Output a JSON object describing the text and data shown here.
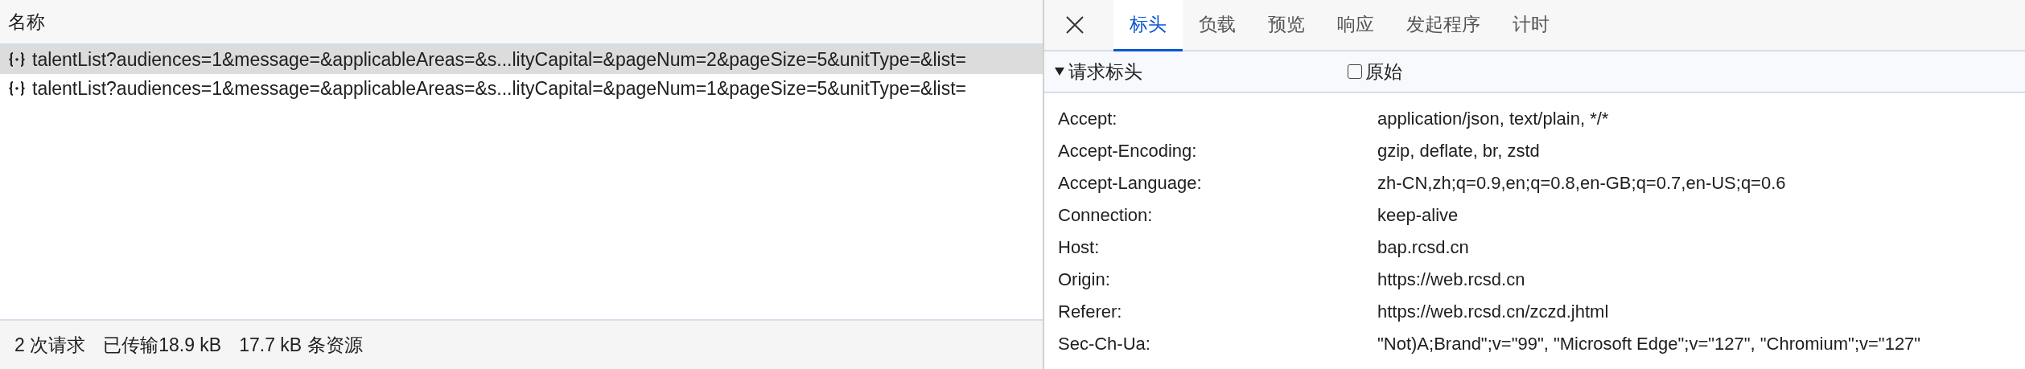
{
  "request_list": {
    "column_header": "名称",
    "rows": [
      {
        "name": "talentList?audiences=1&message=&applicableAreas=&s...lityCapital=&pageNum=2&pageSize=5&unitType=&list=",
        "selected": true
      },
      {
        "name": "talentList?audiences=1&message=&applicableAreas=&s...lityCapital=&pageNum=1&pageSize=5&unitType=&list=",
        "selected": false
      }
    ]
  },
  "status_bar": [
    "2 次请求",
    "已传输18.9 kB",
    "17.7 kB 条资源"
  ],
  "detail": {
    "tabs": [
      {
        "label": "标头",
        "selected": true
      },
      {
        "label": "负载",
        "selected": false
      },
      {
        "label": "预览",
        "selected": false
      },
      {
        "label": "响应",
        "selected": false
      },
      {
        "label": "发起程序",
        "selected": false
      },
      {
        "label": "计时",
        "selected": false
      }
    ],
    "section": {
      "title": "请求标头",
      "expanded": true,
      "raw_checkbox": {
        "label": "原始",
        "checked": false
      }
    },
    "headers": [
      {
        "name": "Accept:",
        "value": "application/json, text/plain, */*"
      },
      {
        "name": "Accept-Encoding:",
        "value": "gzip, deflate, br, zstd"
      },
      {
        "name": "Accept-Language:",
        "value": "zh-CN,zh;q=0.9,en;q=0.8,en-GB;q=0.7,en-US;q=0.6"
      },
      {
        "name": "Connection:",
        "value": "keep-alive"
      },
      {
        "name": "Host:",
        "value": "bap.rcsd.cn"
      },
      {
        "name": "Origin:",
        "value": "https://web.rcsd.cn"
      },
      {
        "name": "Referer:",
        "value": "https://web.rcsd.cn/zczd.jhtml"
      },
      {
        "name": "Sec-Ch-Ua:",
        "value": "\"Not)A;Brand\";v=\"99\", \"Microsoft Edge\";v=\"127\", \"Chromium\";v=\"127\""
      }
    ]
  }
}
